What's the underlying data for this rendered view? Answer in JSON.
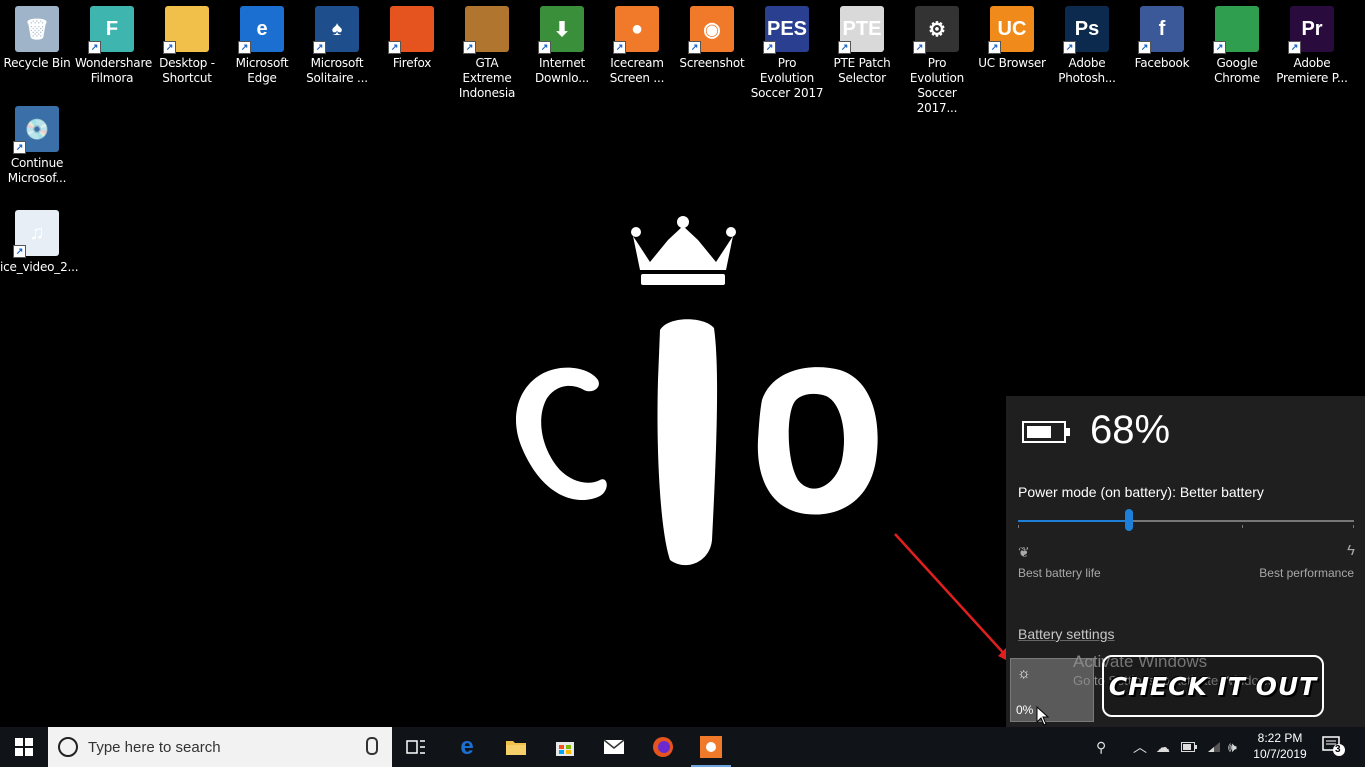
{
  "desktop": {
    "icons": [
      {
        "label": "Recycle Bin",
        "glyph": "🗑",
        "color": "#9fb4c8"
      },
      {
        "label": "Wondershare Filmora",
        "glyph": "F",
        "color": "#3fb5b0"
      },
      {
        "label": "Desktop - Shortcut",
        "glyph": "",
        "color": "#f0c04a"
      },
      {
        "label": "Microsoft Edge",
        "glyph": "e",
        "color": "#1b6fd1"
      },
      {
        "label": "Microsoft Solitaire ...",
        "glyph": "♠",
        "color": "#1e4e8c"
      },
      {
        "label": "Firefox",
        "glyph": "",
        "color": "#e5541f"
      },
      {
        "label": "GTA Extreme Indonesia",
        "glyph": "",
        "color": "#b0752f"
      },
      {
        "label": "Internet Downlo...",
        "glyph": "⬇",
        "color": "#3a8f3a"
      },
      {
        "label": "Icecream Screen ...",
        "glyph": "●",
        "color": "#f07a2a"
      },
      {
        "label": "Screenshot",
        "glyph": "◉",
        "color": "#f07a2a"
      },
      {
        "label": "Pro Evolution Soccer 2017",
        "glyph": "PES",
        "color": "#2a3f8f"
      },
      {
        "label": "PTE Patch Selector",
        "glyph": "PTE",
        "color": "#d9d9d9"
      },
      {
        "label": "Pro Evolution Soccer 2017...",
        "glyph": "⚙",
        "color": "#333333"
      },
      {
        "label": "UC Browser",
        "glyph": "UC",
        "color": "#f08a1a"
      },
      {
        "label": "Adobe Photosh...",
        "glyph": "Ps",
        "color": "#0b2a4e"
      },
      {
        "label": "Facebook",
        "glyph": "f",
        "color": "#3b5998"
      },
      {
        "label": "Google Chrome",
        "glyph": "",
        "color": "#2f9e4f"
      },
      {
        "label": "Adobe Premiere P...",
        "glyph": "Pr",
        "color": "#2a0b3e"
      }
    ],
    "left_icons": [
      {
        "label": "Continue Microsof...",
        "glyph": "💿",
        "color": "#3a6fa8"
      },
      {
        "label": "ice_video_2...",
        "glyph": "♫",
        "color": "#e8eef6"
      }
    ]
  },
  "battery_flyout": {
    "percent": "68%",
    "battery_level": 0.68,
    "power_mode": "Power mode (on battery): Better battery",
    "slider_position": 0.33,
    "best_battery_life": "Best battery life",
    "best_performance": "Best performance",
    "battery_settings": "Battery settings",
    "brightness": "0%"
  },
  "overlay": {
    "activate_title": "Activate Windows",
    "activate_sub": "Go to Settings to activate Windows.",
    "badge": "CHECK IT OUT"
  },
  "taskbar": {
    "search_placeholder": "Type here to search",
    "time": "8:22 PM",
    "date": "10/7/2019",
    "notification_count": "3"
  },
  "colors": {
    "accent": "#1e7fd8",
    "panel": "#1f1f1f",
    "taskbar": "#101418",
    "arrow": "#e02020"
  }
}
